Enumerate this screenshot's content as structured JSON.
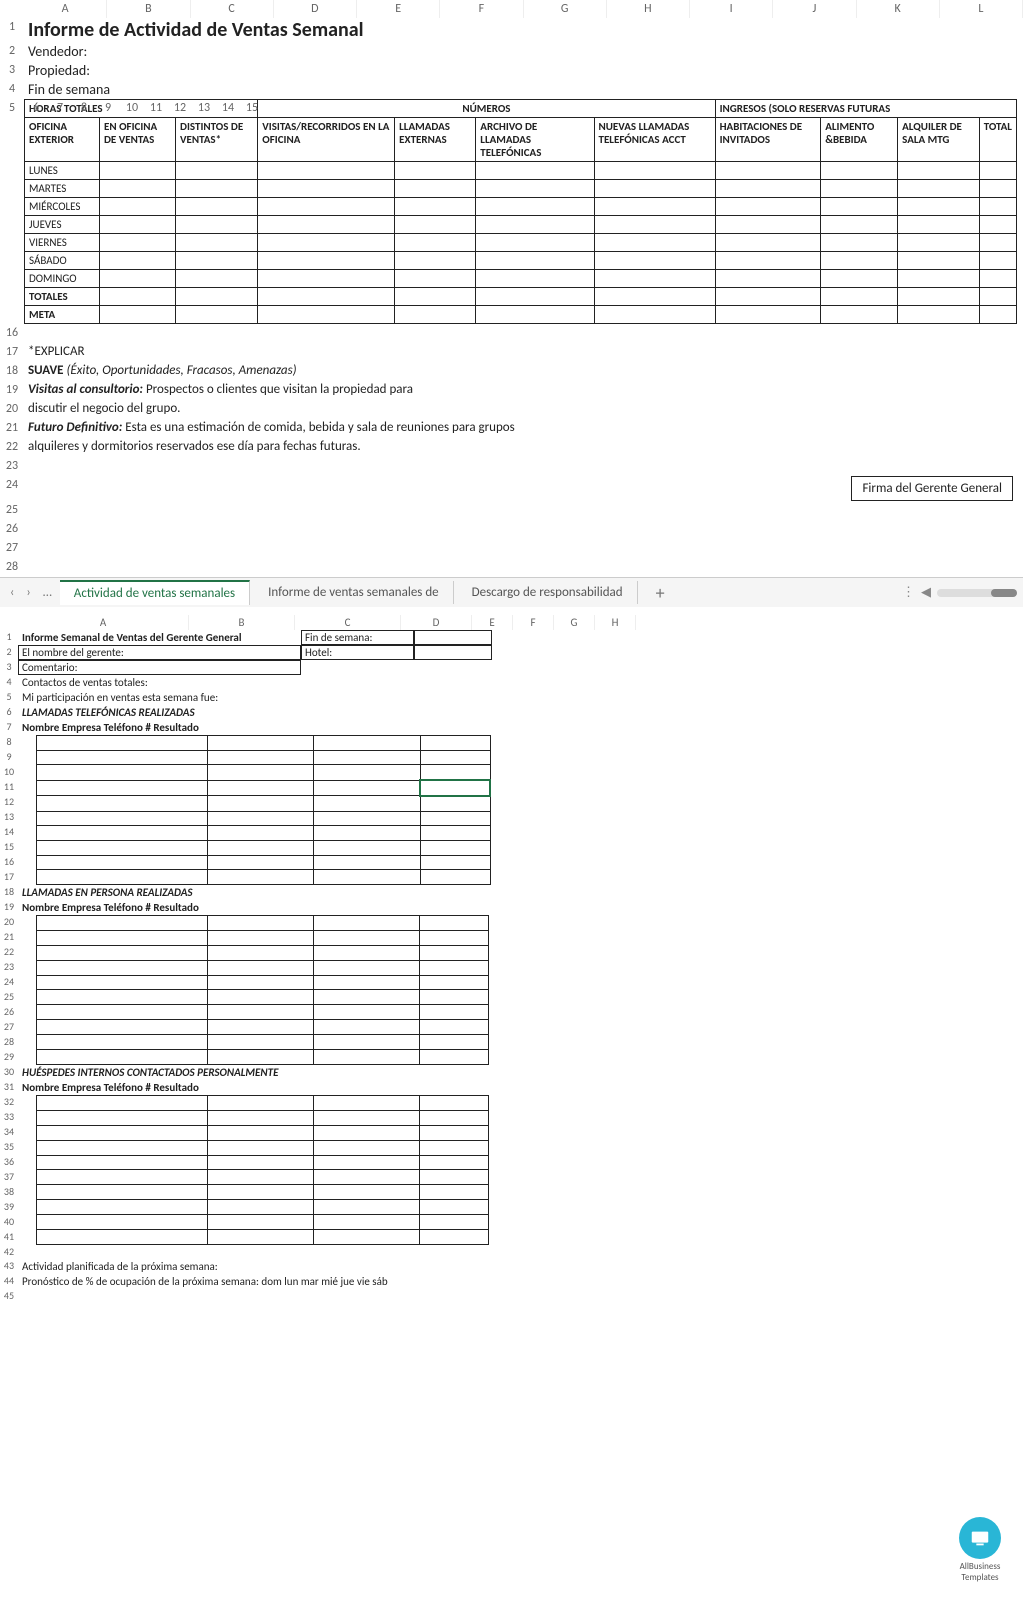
{
  "sheet1": {
    "cols": [
      "A",
      "B",
      "C",
      "D",
      "E",
      "F",
      "G",
      "H",
      "I",
      "J",
      "K",
      "L"
    ],
    "rowsVisible": 28,
    "title": "Informe de Actividad de Ventas Semanal",
    "labels": {
      "vendedor": "Vendedor:",
      "propiedad": "Propiedad:",
      "finsemana": "Fin de semana"
    },
    "groups": {
      "horas": "HORAS TOTALES",
      "numeros": "NÚMEROS",
      "ingresos": "INGRESOS (SOLO RESERVAS FUTURAS"
    },
    "headers": [
      "OFICINA EXTERIOR",
      "EN OFICINA DE VENTAS",
      "DISTINTOS DE VENTAS*",
      "VISITAS/RECORRIDOS EN LA OFICINA",
      "LLAMADAS EXTERNAS",
      "ARCHIVO DE LLAMADAS TELEFÓNICAS",
      "NUEVAS LLAMADAS TELEFÓNICAS ACCT",
      "HABITACIONES DE INVITADOS",
      "ALIMENTO &BEBIDA",
      "ALQUILER DE SALA MTG",
      "TOTAL"
    ],
    "days": [
      "LUNES",
      "MARTES",
      "MIÉRCOLES",
      "JUEVES",
      "VIERNES",
      "SÁBADO",
      "DOMINGO"
    ],
    "totales": "TOTALES",
    "meta": "META",
    "explicar": "*EXPLICAR",
    "suave_b": "SUAVE",
    "suave_i": "(Éxito, Oportunidades, Fracasos, Amenazas)",
    "line19b": "Visitas al consultorio:",
    "line19": "Prospectos o clientes que visitan la propiedad para",
    "line20": "discutir el negocio del grupo.",
    "line21b": "Futuro Definitivo:",
    "line21": "Esta es una estimación de comida, bebida y sala de reuniones para grupos",
    "line22": "alquileres y dormitorios reservados ese día para fechas futuras.",
    "firma": "Firma del Gerente General"
  },
  "tabs": {
    "t1": "Actividad de ventas semanales",
    "t2": "Informe de ventas semanales de",
    "t3": "Descargo de responsabilidad"
  },
  "sheet2": {
    "cols": [
      "A",
      "B",
      "C",
      "D",
      "E",
      "F",
      "G",
      "H"
    ],
    "rowsVisible": 45,
    "r1a": "Informe Semanal de Ventas del Gerente General",
    "r1c": "Fin de semana:",
    "r2a": "El nombre del gerente:",
    "r2c": "Hotel:",
    "r3": "Comentario:",
    "r4": "Contactos de ventas totales:",
    "r5": "Mi participación en ventas esta semana fue:",
    "r6": "LLAMADAS TELEFÓNICAS REALIZADAS",
    "r7": "Nombre Empresa Teléfono # Resultado",
    "r18": "LLAMADAS EN PERSONA REALIZADAS",
    "r19": "Nombre Empresa Teléfono # Resultado",
    "r30": "HUÉSPEDES INTERNOS CONTACTADOS PERSONALMENTE",
    "r31": "Nombre Empresa Teléfono # Resultado",
    "r43": "Actividad planificada de la próxima semana:",
    "r44": "Pronóstico de % de ocupación de la próxima semana: dom lun mar mié jue vie sáb"
  },
  "logo": {
    "line1": "AllBusiness",
    "line2": "Templates"
  }
}
